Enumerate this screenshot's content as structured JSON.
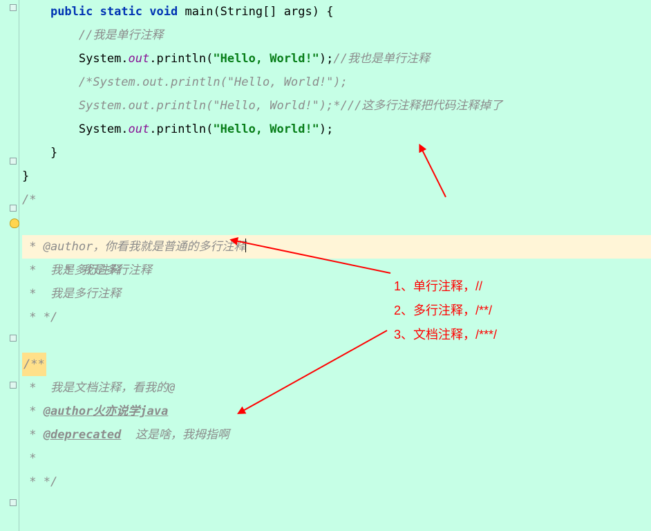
{
  "code": {
    "main_sig_pre": "    ",
    "kw_public": "public",
    "kw_static": "static",
    "kw_void": "void",
    "main_name": " main",
    "main_params": "(String[] args) {",
    "indent2": "        ",
    "line_comment1": "//我是单行注释",
    "sys": "System.",
    "out": "out",
    "println": ".println(",
    "hello": "\"Hello, World!\"",
    "close_call": ");",
    "inline_comment": "//我也是单行注释",
    "block_comment_line1": "/*System.out.println(\"Hello, World!\");",
    "block_comment_line2": "System.out.println(\"Hello, World!\");*/",
    "block_tail_comment": "//这多行注释把代码注释掉了",
    "brace_close1": "    }",
    "brace_close2": "}",
    "mc_open": "/*",
    "mc_line1_star": "*",
    "mc_line1_text": "我是多行注释",
    "mc_line2": " * @author，你看我就是普通的多行注释",
    "mc_line3": " *  我是多行注释",
    "mc_line4": " *  我是多行注释",
    "mc_close": " * */",
    "doc_open": "/**",
    "doc_line1": " *  我是文档注释，看我的@",
    "doc_author_star": " * ",
    "doc_author_tag": "@author",
    "doc_author_text": "火亦说学java",
    "doc_dep_star": " * ",
    "doc_dep_tag": "@deprecated",
    "doc_dep_text": "  这是啥，我拇指啊",
    "doc_blank": " *",
    "doc_close": " * */"
  },
  "annotations": {
    "a1": "1、单行注释，//",
    "a2": "2、多行注释，/**/",
    "a3": "3、文档注释，/***/"
  }
}
